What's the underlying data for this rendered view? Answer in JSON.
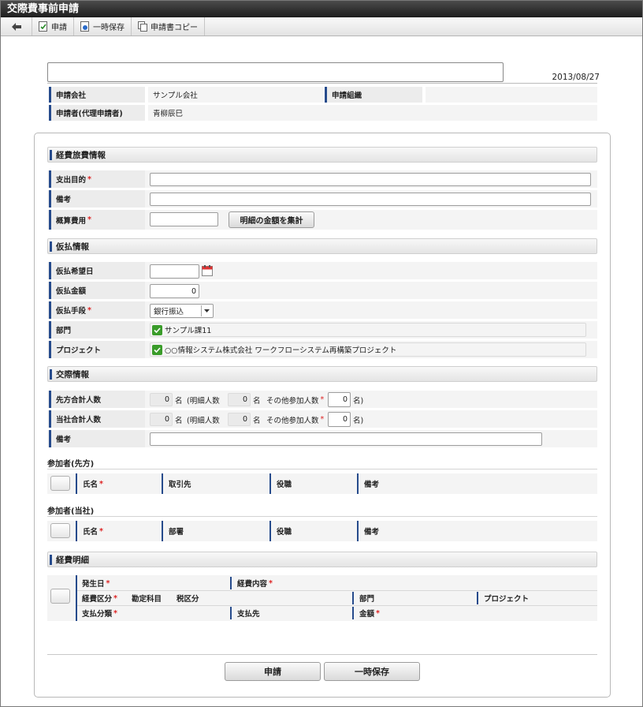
{
  "window": {
    "title": "交際費事前申請"
  },
  "toolbar": {
    "apply": "申請",
    "save": "一時保存",
    "copy": "申請書コピー"
  },
  "header": {
    "date": "2013/08/27",
    "company_label": "申請会社",
    "company_value": "サンプル会社",
    "org_label": "申請組織",
    "org_value": "",
    "applicant_label": "申請者(代理申請者)",
    "applicant_value": "青柳辰巳"
  },
  "expense_info": {
    "title": "経費旅費情報",
    "purpose_label": "支出目的",
    "note_label": "備考",
    "estimate_label": "概算費用",
    "aggregate_button": "明細の金額を集計"
  },
  "advance_info": {
    "title": "仮払情報",
    "date_label": "仮払希望日",
    "amount_label": "仮払金額",
    "amount_value": "0",
    "method_label": "仮払手段",
    "method_value": "銀行振込",
    "dept_label": "部門",
    "dept_value": "サンプル課11",
    "project_label": "プロジェクト",
    "project_value": "○○情報システム株式会社 ワークフローシステム再構築プロジェクト"
  },
  "entertainment": {
    "title": "交際情報",
    "partner_total_label": "先方合計人数",
    "own_total_label": "当社合計人数",
    "note_label": "備考",
    "partner_total": "0",
    "partner_detail": "0",
    "partner_other": "0",
    "own_total": "0",
    "own_detail": "0",
    "own_other": "0",
    "unit": "名",
    "detail_prefix": "(明細人数",
    "other_label": "その他参加人数",
    "close_paren": "名)"
  },
  "participants_partner": {
    "title": "参加者(先方)",
    "cols": [
      "氏名",
      "取引先",
      "役職",
      "備考"
    ]
  },
  "participants_own": {
    "title": "参加者(当社)",
    "cols": [
      "氏名",
      "部署",
      "役職",
      "備考"
    ]
  },
  "details": {
    "title": "経費明細",
    "occur_date": "発生日",
    "content": "経費内容",
    "category": "経費区分",
    "account": "勘定科目",
    "tax": "税区分",
    "dept": "部門",
    "project": "プロジェクト",
    "payment_type": "支払分類",
    "payee": "支払先",
    "amount": "金額"
  },
  "footer": {
    "apply": "申請",
    "save": "一時保存"
  },
  "required_mark": "*"
}
